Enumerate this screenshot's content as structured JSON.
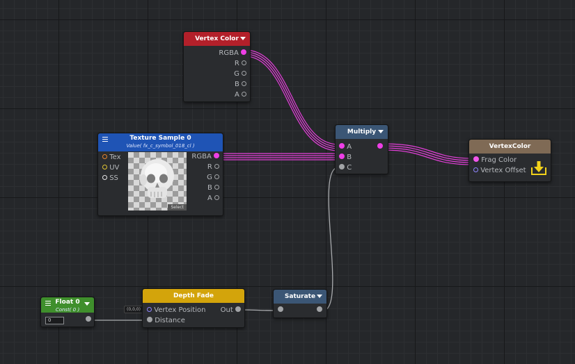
{
  "colors": {
    "vertex_color_header": "#b3202a",
    "texture_header": "#1f54b5",
    "multiply_header": "#3b5675",
    "output_header": "#7f6a55",
    "float_header": "#3f8f2c",
    "depth_fade_header": "#d3a40b",
    "saturate_header": "#3b5675",
    "wire_pink": "#e23fd8",
    "wire_gray": "#a9abae"
  },
  "nodes": {
    "vertex_color": {
      "title": "Vertex Color",
      "outputs": [
        "RGBA",
        "R",
        "G",
        "B",
        "A"
      ]
    },
    "texture_sample": {
      "title": "Texture Sample 0",
      "subtitle": "Value( fx_c_symbol_018_cl )",
      "inputs": [
        "Tex",
        "UV",
        "SS"
      ],
      "outputs": [
        "RGBA",
        "R",
        "G",
        "B",
        "A"
      ],
      "select_label": "Select",
      "preview_icon": "skull-texture-icon"
    },
    "multiply": {
      "title": "Multiply",
      "inputs": [
        "A",
        "B",
        "C"
      ]
    },
    "vertex_color_output": {
      "title": "VertexColor",
      "inputs": [
        "Frag Color",
        "Vertex Offset"
      ],
      "icon": "output-download-icon"
    },
    "float": {
      "title": "Float 0",
      "subtitle": "Const( 0 )",
      "value": "0"
    },
    "depth_fade": {
      "title": "Depth Fade",
      "inputs": [
        "Vertex Position",
        "Distance"
      ],
      "output": "Out",
      "default_vertex_position": "(0,0,0)"
    },
    "saturate": {
      "title": "Saturate"
    }
  }
}
